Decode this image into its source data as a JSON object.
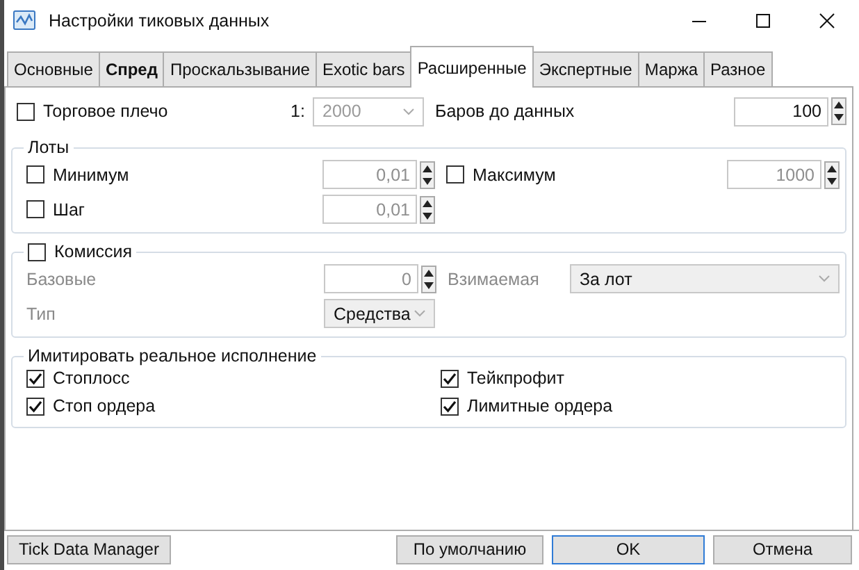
{
  "window": {
    "title": "Настройки тиковых данных"
  },
  "tabs": [
    {
      "label": "Основные",
      "selected": false,
      "bold": false
    },
    {
      "label": "Спред",
      "selected": false,
      "bold": true
    },
    {
      "label": "Проскальзывание",
      "selected": false,
      "bold": false
    },
    {
      "label": "Exotic bars",
      "selected": false,
      "bold": false
    },
    {
      "label": "Расширенные",
      "selected": true,
      "bold": false
    },
    {
      "label": "Экспертные",
      "selected": false,
      "bold": false
    },
    {
      "label": "Маржа",
      "selected": false,
      "bold": false
    },
    {
      "label": "Разное",
      "selected": false,
      "bold": false
    }
  ],
  "leverage": {
    "label": "Торговое плечо",
    "checked": false,
    "prefix": "1:",
    "value": "2000",
    "disabled": true
  },
  "bars_to_data": {
    "label": "Баров до данных",
    "value": "100",
    "disabled": false
  },
  "lots": {
    "title": "Лоты",
    "minimum": {
      "label": "Минимум",
      "checked": false,
      "value": "0,01",
      "disabled": true
    },
    "maximum": {
      "label": "Максимум",
      "checked": false,
      "value": "1000",
      "disabled": true
    },
    "step": {
      "label": "Шаг",
      "checked": false,
      "value": "0,01",
      "disabled": true
    }
  },
  "commission": {
    "label": "Комиссия",
    "checked": false,
    "disabled": true,
    "base": {
      "label": "Базовые",
      "value": "0"
    },
    "charged": {
      "label": "Взимаемая",
      "value": "За лот"
    },
    "type": {
      "label": "Тип",
      "value": "Средства"
    }
  },
  "execution": {
    "title": "Имитировать реальное исполнение",
    "options": [
      {
        "label": "Стоплосс",
        "checked": true
      },
      {
        "label": "Тейкпрофит",
        "checked": true
      },
      {
        "label": "Стоп ордера",
        "checked": true
      },
      {
        "label": "Лимитные ордера",
        "checked": true
      }
    ]
  },
  "buttons": [
    {
      "label": "Tick Data Manager",
      "focused": false
    },
    {
      "label": "По умолчанию",
      "focused": false
    },
    {
      "label": "OK",
      "focused": true
    },
    {
      "label": "Отмена",
      "focused": false
    }
  ]
}
